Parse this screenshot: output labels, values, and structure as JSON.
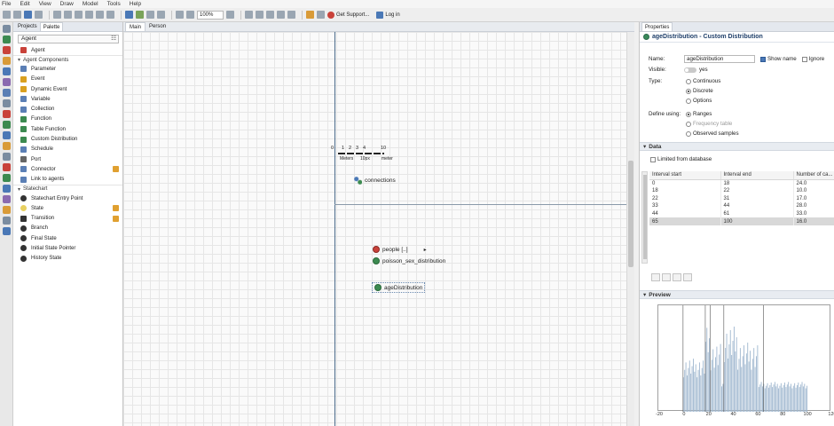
{
  "menu": [
    "File",
    "Edit",
    "View",
    "Draw",
    "Model",
    "Tools",
    "Help"
  ],
  "toolbar": {
    "zoom": "100%",
    "get_support": "Get Support...",
    "login": "Log in"
  },
  "palette": {
    "tabs": [
      "Projects",
      "Palette"
    ],
    "category": "Agent",
    "items": [
      {
        "label": "Agent",
        "icon": "agent-icon",
        "color": "#c9423a"
      },
      {
        "section": "Agent Components"
      },
      {
        "label": "Parameter",
        "icon": "parameter-icon",
        "color": "#5b7fb5"
      },
      {
        "label": "Event",
        "icon": "event-icon",
        "color": "#d9a020"
      },
      {
        "label": "Dynamic Event",
        "icon": "dynamic-event-icon",
        "color": "#d9a020"
      },
      {
        "label": "Variable",
        "icon": "variable-icon",
        "color": "#5b7fb5"
      },
      {
        "label": "Collection",
        "icon": "collection-icon",
        "color": "#5b7fb5"
      },
      {
        "label": "Function",
        "icon": "function-icon",
        "color": "#3c8a50"
      },
      {
        "label": "Table Function",
        "icon": "table-function-icon",
        "color": "#3c8a50"
      },
      {
        "label": "Custom Distribution",
        "icon": "custom-distribution-icon",
        "color": "#3c8a50"
      },
      {
        "label": "Schedule",
        "icon": "schedule-icon",
        "color": "#5b7fb5"
      },
      {
        "label": "Port",
        "icon": "port-icon",
        "color": "#666666"
      },
      {
        "label": "Connector",
        "icon": "connector-icon",
        "color": "#5b7fb5",
        "badge": true
      },
      {
        "label": "Link to agents",
        "icon": "link-icon",
        "color": "#5b7fb5"
      },
      {
        "section": "Statechart"
      },
      {
        "label": "Statechart Entry Point",
        "icon": "entry-point-icon",
        "color": "#333333"
      },
      {
        "label": "State",
        "icon": "state-icon",
        "color": "#e8d060",
        "badge": true
      },
      {
        "label": "Transition",
        "icon": "transition-icon",
        "color": "#333333",
        "badge": true
      },
      {
        "label": "Branch",
        "icon": "branch-icon",
        "color": "#333333"
      },
      {
        "label": "Final State",
        "icon": "final-state-icon",
        "color": "#333333"
      },
      {
        "label": "Initial State Pointer",
        "icon": "initial-state-icon",
        "color": "#333333"
      },
      {
        "label": "History State",
        "icon": "history-state-icon",
        "color": "#333333"
      }
    ]
  },
  "editor": {
    "tabs": [
      "Main",
      "Person"
    ],
    "objects": [
      {
        "label": "connections",
        "icon": "connections-icon"
      },
      {
        "label": "people [..]",
        "icon": "population-icon"
      },
      {
        "label": "poisson_sex_distribution",
        "icon": "distribution-icon"
      },
      {
        "label": "ageDistribution",
        "icon": "custom-distribution-icon"
      }
    ],
    "scale": {
      "left": "0",
      "ticks": [
        "1",
        "2",
        "3",
        "4"
      ],
      "right": "10",
      "unit1": "Meters",
      "unit2": "10px",
      "label2": "meter"
    }
  },
  "properties": {
    "tab": "Properties",
    "title": "ageDistribution - Custom Distribution",
    "name_label": "Name:",
    "name_value": "ageDistribution",
    "show_name_label": "Show name",
    "ignore_label": "Ignore",
    "visible_label": "Visible:",
    "visible_value": "yes",
    "type_label": "Type:",
    "type_options": [
      "Continuous",
      "Discrete",
      "Options"
    ],
    "type_selected": 1,
    "define_label": "Define using:",
    "define_options": [
      "Ranges",
      "Frequency table",
      "Observed samples"
    ],
    "define_selected": 0,
    "data_section": "Data",
    "limited_label": "Limited from database",
    "columns": [
      "Interval start",
      "Interval end",
      "Number of ca..."
    ],
    "rows": [
      [
        "0",
        "18",
        "24.0"
      ],
      [
        "18",
        "22",
        "10.0"
      ],
      [
        "22",
        "31",
        "17.0"
      ],
      [
        "33",
        "44",
        "28.0"
      ],
      [
        "44",
        "61",
        "33.0"
      ],
      [
        "65",
        "100",
        "16.0"
      ]
    ],
    "preview_section": "Preview",
    "preview_ticks": [
      "-20",
      "0",
      "20",
      "40",
      "60",
      "80",
      "100",
      "120"
    ]
  },
  "colors": {
    "accent": "#1f3f6a",
    "bar": "#9fb7cf",
    "axis": "#4a6a8a"
  }
}
